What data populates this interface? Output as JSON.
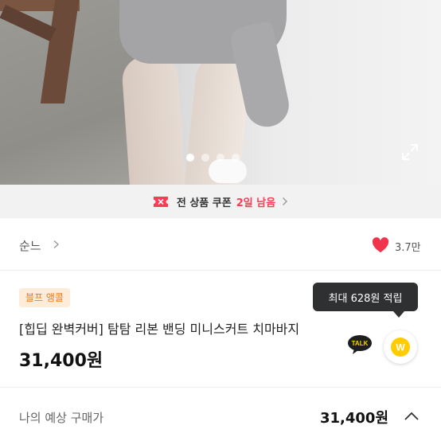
{
  "gallery": {
    "total_images": 4,
    "active_index": 0,
    "expand_icon": "expand-icon"
  },
  "coupon": {
    "icon": "coupon-ticket-icon",
    "label": "전 상품 쿠폰",
    "remaining": "2일 남음",
    "accent_color": "#ff3b53"
  },
  "seller": {
    "name": "순느",
    "like_count": "3.7만",
    "heart_color": "#f0344c"
  },
  "product": {
    "badge": "블프 앵콜",
    "title": "[힙딥 완벽커버] 탐탐 리본 밴딩 미니스커트 치마바지",
    "price": "31,400원",
    "reward_tooltip": "최대 628원 적립"
  },
  "actions": {
    "talk_label": "TALK",
    "coin_label": "W"
  },
  "summary": {
    "expected_label": "나의 예상 구매가",
    "expected_price": "31,400원"
  }
}
